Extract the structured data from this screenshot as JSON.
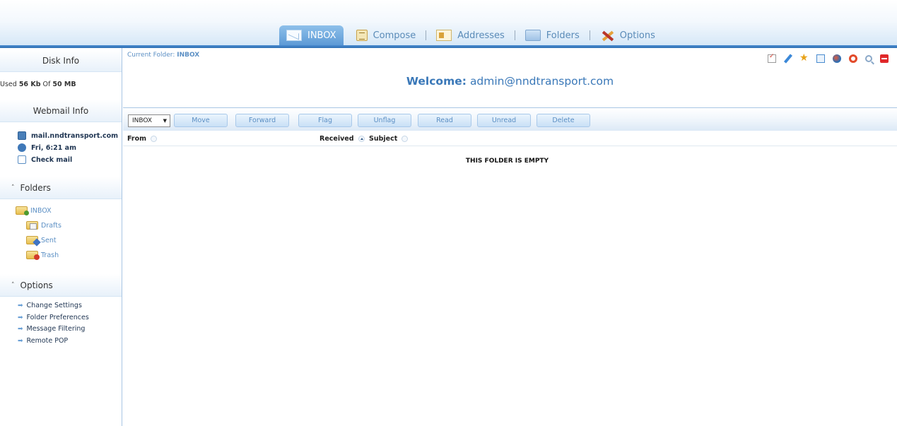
{
  "tabs": [
    {
      "label": "INBOX",
      "icon": "mail-icon",
      "active": true
    },
    {
      "label": "Compose",
      "icon": "compose-icon",
      "active": false
    },
    {
      "label": "Addresses",
      "icon": "address-book-icon",
      "active": false
    },
    {
      "label": "Folders",
      "icon": "folder-icon",
      "active": false
    },
    {
      "label": "Options",
      "icon": "tools-icon",
      "active": false
    }
  ],
  "sidebar": {
    "disk_info": {
      "title": "Disk Info",
      "used_label": "Used",
      "used_value": "56 Kb",
      "of_label": "Of",
      "quota": "50 MB"
    },
    "webmail_info": {
      "title": "Webmail Info",
      "host": "mail.nndtransport.com",
      "time": "Fri, 6:21 am",
      "check_mail": "Check mail"
    },
    "folders": {
      "title": "Folders",
      "items": [
        "INBOX",
        "Drafts",
        "Sent",
        "Trash"
      ]
    },
    "options": {
      "title": "Options",
      "items": [
        "Change Settings",
        "Folder Preferences",
        "Message Filtering",
        "Remote POP"
      ]
    }
  },
  "main": {
    "current_folder_label": "Current Folder:",
    "current_folder": "INBOX",
    "welcome_label": "Welcome:",
    "welcome_email": "admin@nndtransport.com",
    "folder_select": "INBOX",
    "buttons": [
      "Move",
      "Forward",
      "Flag",
      "Unflag",
      "Read",
      "Unread",
      "Delete"
    ],
    "columns": {
      "from": "From",
      "received": "Received",
      "subject": "Subject"
    },
    "empty_message": "THIS FOLDER IS EMPTY"
  },
  "colors": {
    "accent": "#3a78b8",
    "link": "#5b8fc4",
    "tab_active": "#6ea8de",
    "logout": "#e0282a"
  }
}
